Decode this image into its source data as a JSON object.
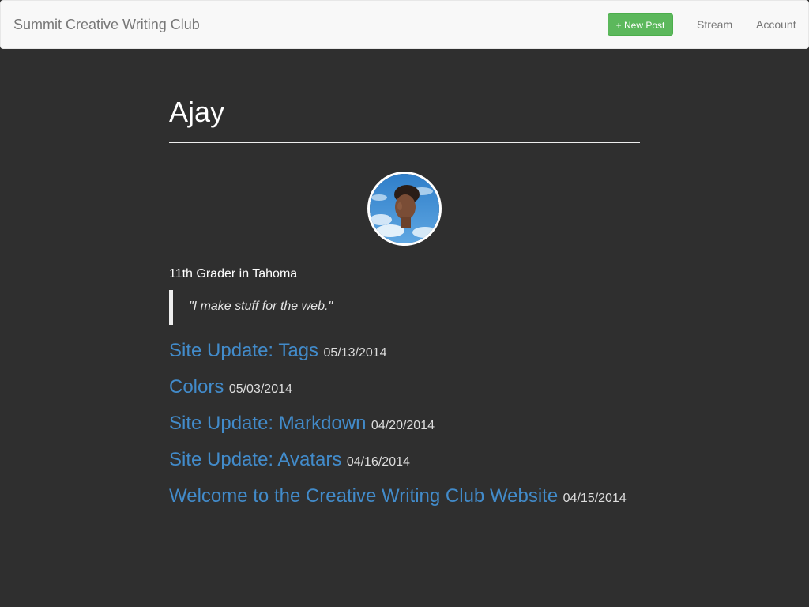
{
  "navbar": {
    "brand": "Summit Creative Writing Club",
    "new_post_label": "+ New Post",
    "links": [
      {
        "label": "Stream"
      },
      {
        "label": "Account"
      }
    ]
  },
  "profile": {
    "name": "Ajay",
    "bio": "11th Grader in Tahoma",
    "quote": "\"I make stuff for the web.\""
  },
  "posts": [
    {
      "title": "Site Update: Tags",
      "date": "05/13/2014"
    },
    {
      "title": "Colors",
      "date": "05/03/2014"
    },
    {
      "title": "Site Update: Markdown",
      "date": "04/20/2014"
    },
    {
      "title": "Site Update: Avatars",
      "date": "04/16/2014"
    },
    {
      "title": "Welcome to the Creative Writing Club Website",
      "date": "04/15/2014"
    }
  ],
  "colors": {
    "background": "#2f2f2f",
    "navbar": "#f8f8f8",
    "button_green": "#5cb85c",
    "link_blue": "#428bca"
  },
  "icons": {
    "avatar": "avatar-image"
  }
}
